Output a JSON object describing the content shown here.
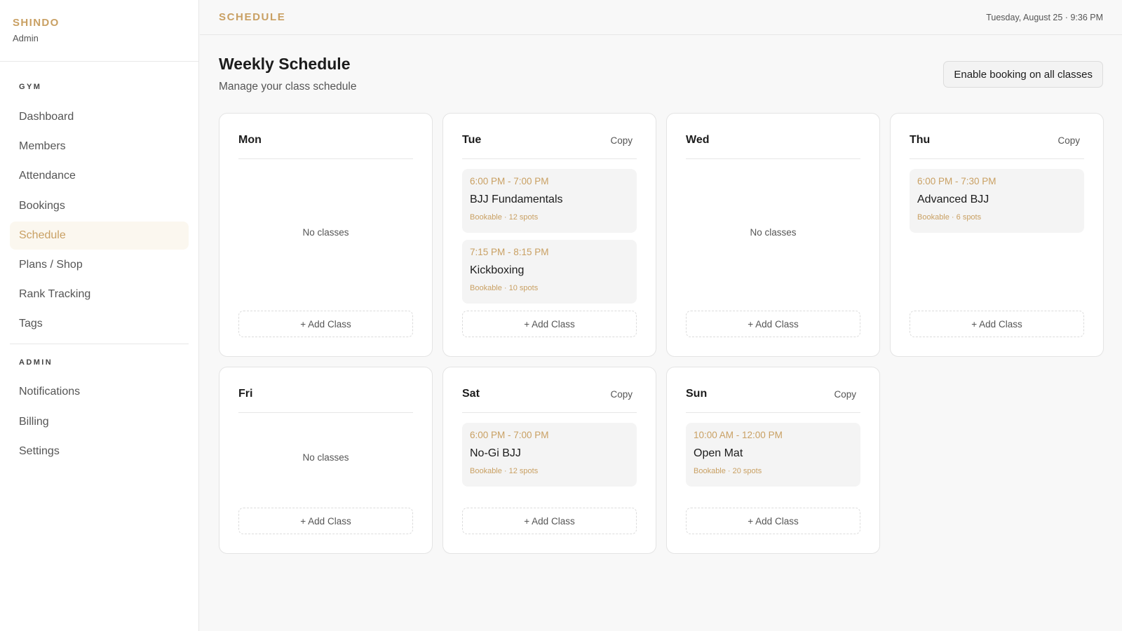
{
  "brand": {
    "name": "SHINDO",
    "role": "Admin"
  },
  "sidebar": {
    "gym_label": "GYM",
    "gym_items": [
      "Dashboard",
      "Members",
      "Attendance",
      "Bookings",
      "Schedule",
      "Plans / Shop",
      "Rank Tracking",
      "Tags"
    ],
    "active_item": "Schedule",
    "admin_label": "ADMIN",
    "admin_items": [
      "Notifications",
      "Billing",
      "Settings"
    ]
  },
  "header": {
    "title": "SCHEDULE",
    "datetime": "Tuesday, August 25 · 9:36 PM"
  },
  "page": {
    "title": "Weekly Schedule",
    "subtitle": "Manage your class schedule",
    "enable_button": "Enable booking on all classes"
  },
  "labels": {
    "copy": "Copy",
    "add_class": "+ Add Class",
    "no_classes": "No classes"
  },
  "days": [
    {
      "name": "Mon",
      "copy": false,
      "classes": []
    },
    {
      "name": "Tue",
      "copy": true,
      "classes": [
        {
          "time": "6:00 PM - 7:00 PM",
          "name": "BJJ Fundamentals",
          "meta": "Bookable · 12 spots"
        },
        {
          "time": "7:15 PM - 8:15 PM",
          "name": "Kickboxing",
          "meta": "Bookable · 10 spots"
        }
      ]
    },
    {
      "name": "Wed",
      "copy": false,
      "classes": []
    },
    {
      "name": "Thu",
      "copy": true,
      "classes": [
        {
          "time": "6:00 PM - 7:30 PM",
          "name": "Advanced BJJ",
          "meta": "Bookable · 6 spots"
        }
      ]
    },
    {
      "name": "Fri",
      "copy": false,
      "classes": []
    },
    {
      "name": "Sat",
      "copy": true,
      "classes": [
        {
          "time": "6:00 PM - 7:00 PM",
          "name": "No-Gi BJJ",
          "meta": "Bookable · 12 spots"
        }
      ]
    },
    {
      "name": "Sun",
      "copy": true,
      "classes": [
        {
          "time": "10:00 AM - 12:00 PM",
          "name": "Open Mat",
          "meta": "Bookable · 20 spots"
        }
      ]
    }
  ],
  "colors": {
    "accent": "#c9a063",
    "active_bg": "#fbf7ef"
  }
}
